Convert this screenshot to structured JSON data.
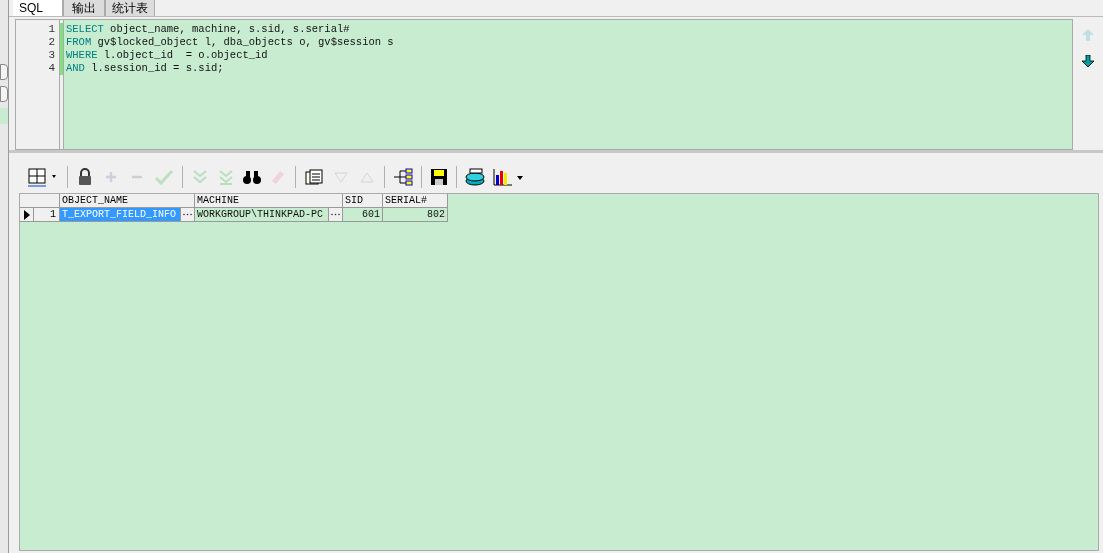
{
  "tabs": [
    {
      "label": "SQL",
      "selected": true
    },
    {
      "label": "输出",
      "selected": false
    },
    {
      "label": "统计表",
      "selected": false
    }
  ],
  "editor": {
    "lines": [
      {
        "number": "1",
        "keyword": "SELECT",
        "rest": " object_name, machine, s.sid, s.serial#"
      },
      {
        "number": "2",
        "keyword": "FROM",
        "rest": " gv$locked_object l, dba_objects o, gv$session s"
      },
      {
        "number": "3",
        "keyword": "WHERE",
        "rest": " l.object_id  = o.object_id"
      },
      {
        "number": "4",
        "keyword": "AND",
        "rest": " l.session_id = s.sid;"
      }
    ],
    "scroll_up": {
      "disabled": true
    },
    "scroll_down": {
      "disabled": false
    }
  },
  "toolbar": [
    {
      "disabled": false
    },
    {
      "disabled": false
    },
    {
      "disabled": true
    },
    {
      "disabled": true
    },
    {
      "disabled": true
    },
    {
      "disabled": true
    },
    {
      "disabled": true
    },
    {
      "disabled": false
    },
    {
      "disabled": true
    },
    {
      "disabled": false
    },
    {
      "disabled": true
    },
    {
      "disabled": true
    },
    {
      "disabled": false
    },
    {
      "disabled": false
    },
    {
      "disabled": false
    },
    {
      "disabled": false
    }
  ],
  "grid": {
    "columns": [
      {
        "label": "OBJECT_NAME",
        "kind": "text"
      },
      {
        "label": "MACHINE",
        "kind": "text"
      },
      {
        "label": "SID",
        "kind": "number"
      },
      {
        "label": "SERIAL#",
        "kind": "number"
      }
    ],
    "rows": [
      {
        "number": "1",
        "current": true,
        "cells": [
          {
            "text": "T_EXPORT_FIELD_INFO",
            "selected": true
          },
          {
            "text": "WORKGROUP\\THINKPAD-PC",
            "selected": false
          },
          {
            "text": "601",
            "selected": false
          },
          {
            "text": "802",
            "selected": false
          }
        ]
      }
    ]
  }
}
